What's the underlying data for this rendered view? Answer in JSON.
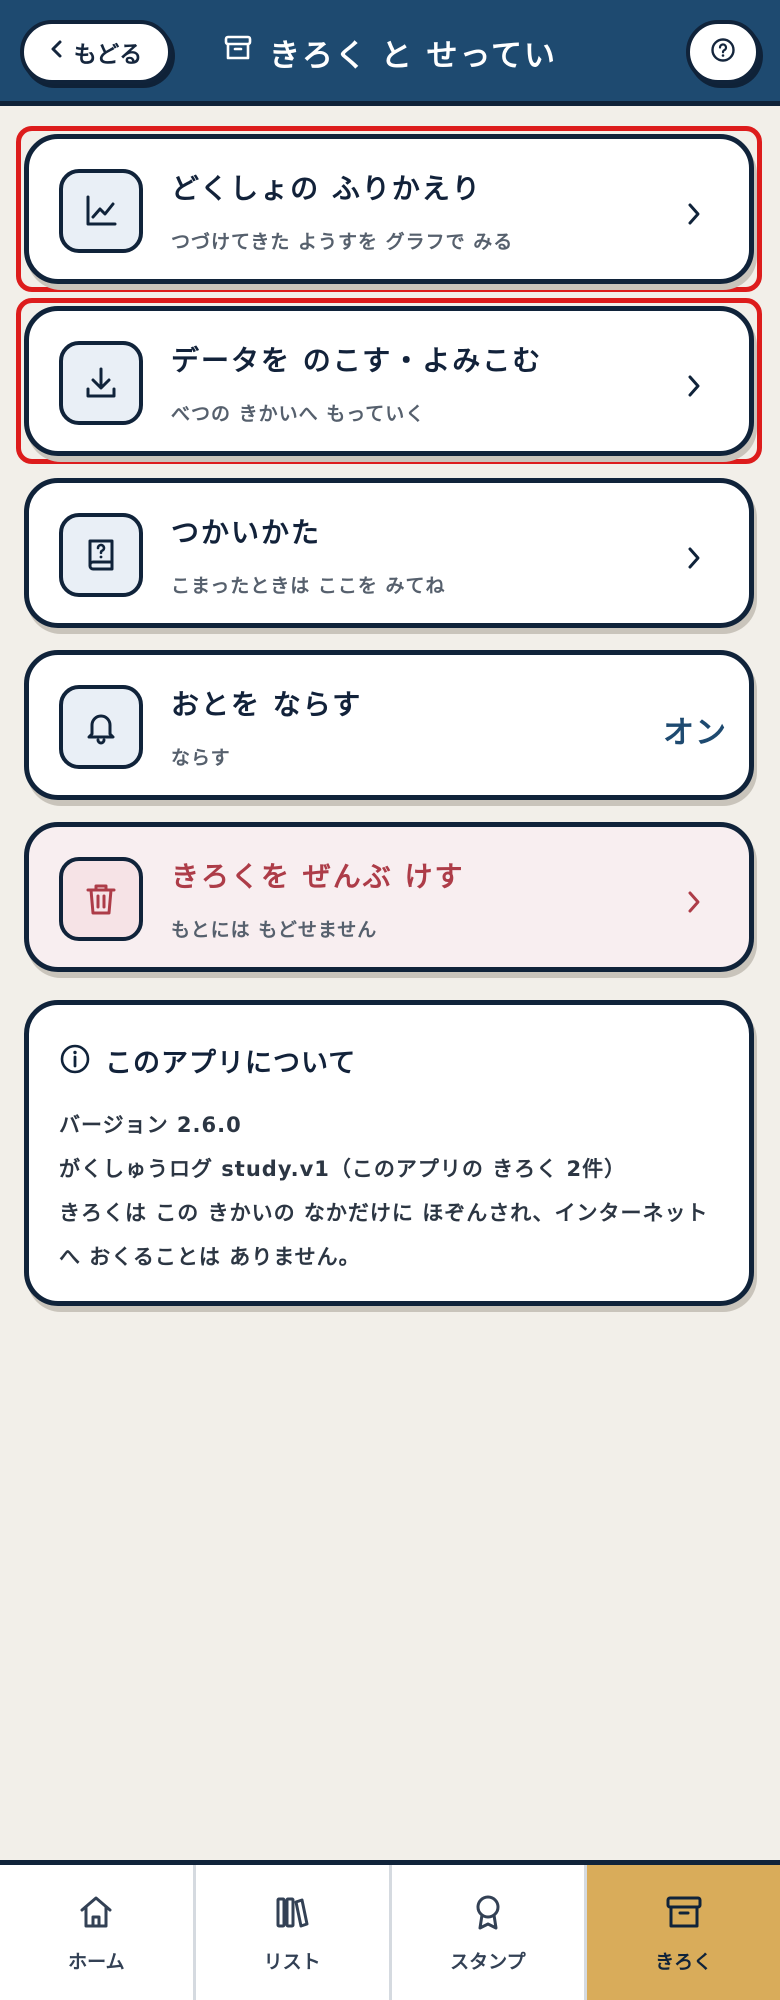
{
  "header": {
    "back_label": "もどる",
    "title": "きろく と せってい"
  },
  "menu": [
    {
      "title": "どくしょの ふりかえり",
      "subtitle": "つづけてきた ようすを グラフで みる",
      "icon": "chart-line-icon"
    },
    {
      "title": "データを のこす・よみこむ",
      "subtitle": "べつの きかいへ もっていく",
      "icon": "download-icon"
    },
    {
      "title": "つかいかた",
      "subtitle": "こまったときは ここを みてね",
      "icon": "help-book-icon"
    },
    {
      "title": "おとを ならす",
      "subtitle": "ならす",
      "value": "オン",
      "icon": "bell-icon"
    },
    {
      "title": "きろくを ぜんぶ けす",
      "subtitle": "もとには もどせません",
      "icon": "trash-icon"
    }
  ],
  "about": {
    "title": "このアプリについて",
    "version": "バージョン 2.6.0",
    "storage": "がくしゅうログ study.v1（このアプリの きろく 2件）",
    "privacy": "きろくは この きかいの なかだけに ほぞんされ、インターネットへ おくることは ありません。"
  },
  "nav": {
    "items": [
      {
        "label": "ホーム",
        "icon": "home-icon"
      },
      {
        "label": "リスト",
        "icon": "books-icon"
      },
      {
        "label": "スタンプ",
        "icon": "badge-icon"
      },
      {
        "label": "きろく",
        "icon": "archive-icon",
        "active": true
      }
    ]
  },
  "colors": {
    "header": "#1e4a70",
    "accent_gold": "#d9ac5a",
    "danger": "#ad3c48",
    "highlight": "#dd1c1c"
  }
}
